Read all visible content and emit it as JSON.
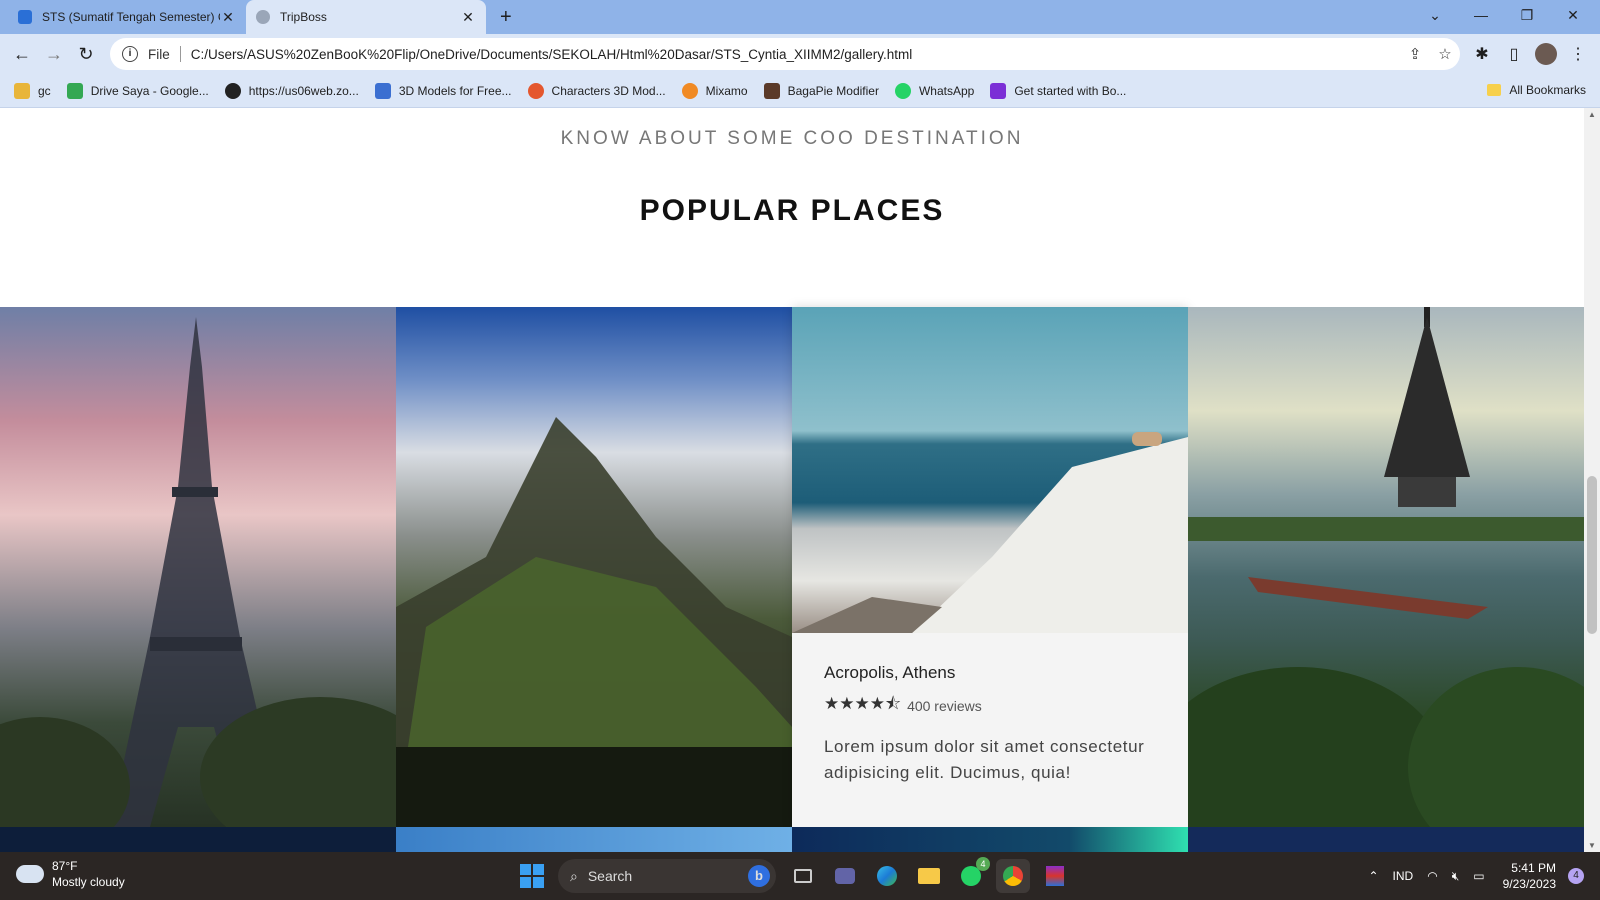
{
  "browser": {
    "tabs": [
      {
        "title": "STS (Sumatif Tengah Semester) C",
        "close": "✕"
      },
      {
        "title": "TripBoss",
        "close": "✕"
      }
    ],
    "new_tab": "+",
    "window_controls": {
      "dropdown": "⌄",
      "minimize": "—",
      "restore": "❐",
      "close": "✕"
    },
    "nav": {
      "back": "←",
      "forward": "→",
      "reload": "↻"
    },
    "address": {
      "scheme_label": "File",
      "url": "C:/Users/ASUS%20ZenBooK%20Flip/OneDrive/Documents/SEKOLAH/Html%20Dasar/STS_Cyntia_XIIMM2/gallery.html"
    },
    "bookmarks": [
      {
        "label": "gc",
        "color": "#e8b53a"
      },
      {
        "label": "Drive Saya - Google...",
        "color": "#34a853"
      },
      {
        "label": "https://us06web.zo...",
        "color": "#222222"
      },
      {
        "label": "3D Models for Free...",
        "color": "#3b6fd1"
      },
      {
        "label": "Characters 3D Mod...",
        "color": "#e4572e"
      },
      {
        "label": "Mixamo",
        "color": "#f08a24"
      },
      {
        "label": "BagaPie Modifier",
        "color": "#5b3a29"
      },
      {
        "label": "WhatsApp",
        "color": "#25d366"
      },
      {
        "label": "Get started with Bo...",
        "color": "#7b2fd6"
      }
    ],
    "all_bookmarks": "All Bookmarks"
  },
  "page": {
    "kicker": "KNOW ABOUT SOME COO DESTINATION",
    "heading": "POPULAR PLACES",
    "featured": {
      "place": "Acropolis, Athens",
      "stars": "★★★★⯪",
      "reviews": "400 reviews",
      "rating": 4.5,
      "description": "Lorem ipsum dolor sit amet consectetur adipisicing elit. Ducimus, quia!"
    }
  },
  "taskbar": {
    "weather_temp": "87°F",
    "weather_desc": "Mostly cloudy",
    "search_label": "Search",
    "whatsapp_badge": "4",
    "language": "IND",
    "time": "5:41 PM",
    "date": "9/23/2023",
    "notification_count": "4"
  }
}
